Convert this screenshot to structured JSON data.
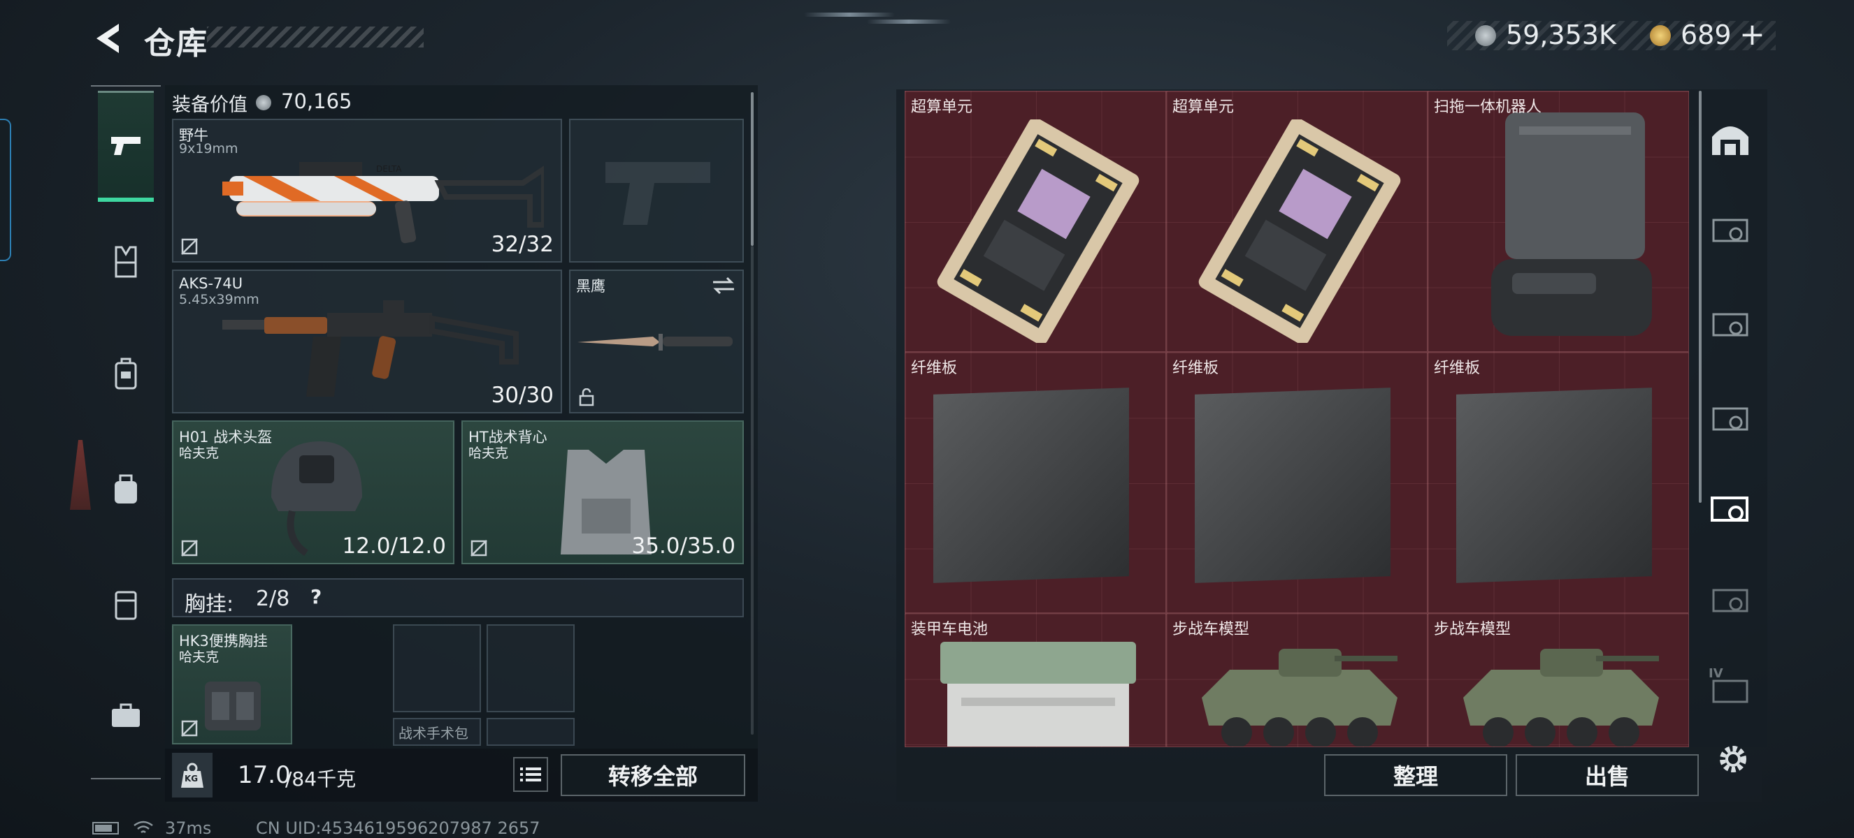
{
  "header": {
    "title": "仓库",
    "currency_silver": "59,353K",
    "currency_gold": "689",
    "add_symbol": "+"
  },
  "equipment": {
    "value_label": "装备价值",
    "value": "70,165",
    "primary_weapon": {
      "name": "野牛",
      "ammo": "9x19mm",
      "count": "32/32",
      "decal": "DELTA"
    },
    "secondary_weapon": {
      "name": "AKS-74U",
      "ammo": "5.45x39mm",
      "count": "30/30"
    },
    "melee": {
      "name": "黑鹰"
    },
    "helmet": {
      "name": "H01 战术头盔",
      "brand": "哈夫克",
      "durability": "12.0/12.0"
    },
    "armor": {
      "name": "HT战术背心",
      "brand": "哈夫克",
      "durability": "35.0/35.0"
    },
    "chest_rig": {
      "label": "胸挂:",
      "capacity": "2/8",
      "help": "?",
      "name": "HK3便携胸挂",
      "brand": "哈夫克"
    },
    "pouch_label": "战术手术包"
  },
  "bottom_left": {
    "kg_icon_text": "KG",
    "weight": "17.0",
    "weight_max": "/84千克",
    "transfer_all": "转移全部"
  },
  "grid": {
    "items": [
      {
        "name": "超算单元"
      },
      {
        "name": "超算单元"
      },
      {
        "name": "扫拖一体机器人"
      },
      {
        "name": "纤维板"
      },
      {
        "name": "纤维板"
      },
      {
        "name": "纤维板"
      },
      {
        "name": "装甲车电池"
      },
      {
        "name": "步战车模型"
      },
      {
        "name": "步战车模型"
      }
    ]
  },
  "right_tabs": {
    "roman_label": "IV"
  },
  "actions": {
    "sort": "整理",
    "sell": "出售"
  },
  "status": {
    "ping": "37ms",
    "uid": "CN UID:4534619596207987 2657"
  },
  "colors": {
    "accent_green": "#3ed7a0",
    "grid_red": "#4c1f27"
  }
}
